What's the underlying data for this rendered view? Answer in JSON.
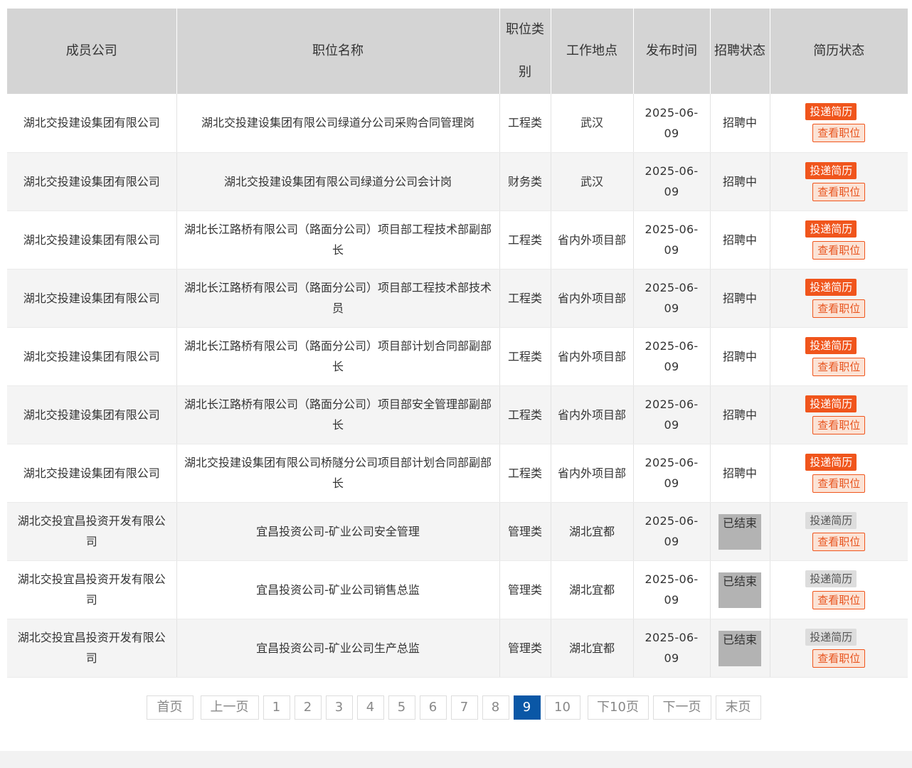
{
  "table": {
    "headers": {
      "company": "成员公司",
      "position": "职位名称",
      "category": "职位类别",
      "location": "工作地点",
      "publish_time": "发布时间",
      "recruit_status": "招聘状态",
      "resume_status": "简历状态"
    },
    "rows": [
      {
        "company": "湖北交投建设集团有限公司",
        "position": "湖北交投建设集团有限公司绿道分公司采购合同管理岗",
        "category": "工程类",
        "location": "武汉",
        "date": "2025-06-09",
        "status": "招聘中",
        "ended": false,
        "apply": "投递简历",
        "view": "查看职位"
      },
      {
        "company": "湖北交投建设集团有限公司",
        "position": "湖北交投建设集团有限公司绿道分公司会计岗",
        "category": "财务类",
        "location": "武汉",
        "date": "2025-06-09",
        "status": "招聘中",
        "ended": false,
        "apply": "投递简历",
        "view": "查看职位"
      },
      {
        "company": "湖北交投建设集团有限公司",
        "position": "湖北长江路桥有限公司（路面分公司）项目部工程技术部副部长",
        "category": "工程类",
        "location": "省内外项目部",
        "date": "2025-06-09",
        "status": "招聘中",
        "ended": false,
        "apply": "投递简历",
        "view": "查看职位"
      },
      {
        "company": "湖北交投建设集团有限公司",
        "position": "湖北长江路桥有限公司（路面分公司）项目部工程技术部技术员",
        "category": "工程类",
        "location": "省内外项目部",
        "date": "2025-06-09",
        "status": "招聘中",
        "ended": false,
        "apply": "投递简历",
        "view": "查看职位"
      },
      {
        "company": "湖北交投建设集团有限公司",
        "position": "湖北长江路桥有限公司（路面分公司）项目部计划合同部副部长",
        "category": "工程类",
        "location": "省内外项目部",
        "date": "2025-06-09",
        "status": "招聘中",
        "ended": false,
        "apply": "投递简历",
        "view": "查看职位"
      },
      {
        "company": "湖北交投建设集团有限公司",
        "position": "湖北长江路桥有限公司（路面分公司）项目部安全管理部副部长",
        "category": "工程类",
        "location": "省内外项目部",
        "date": "2025-06-09",
        "status": "招聘中",
        "ended": false,
        "apply": "投递简历",
        "view": "查看职位"
      },
      {
        "company": "湖北交投建设集团有限公司",
        "position": "湖北交投建设集团有限公司桥隧分公司项目部计划合同部副部长",
        "category": "工程类",
        "location": "省内外项目部",
        "date": "2025-06-09",
        "status": "招聘中",
        "ended": false,
        "apply": "投递简历",
        "view": "查看职位"
      },
      {
        "company": "湖北交投宜昌投资开发有限公司",
        "position": "宜昌投资公司-矿业公司安全管理",
        "category": "管理类",
        "location": "湖北宜都",
        "date": "2025-06-09",
        "status": "已结束",
        "ended": true,
        "apply": "投递简历",
        "view": "查看职位"
      },
      {
        "company": "湖北交投宜昌投资开发有限公司",
        "position": "宜昌投资公司-矿业公司销售总监",
        "category": "管理类",
        "location": "湖北宜都",
        "date": "2025-06-09",
        "status": "已结束",
        "ended": true,
        "apply": "投递简历",
        "view": "查看职位"
      },
      {
        "company": "湖北交投宜昌投资开发有限公司",
        "position": "宜昌投资公司-矿业公司生产总监",
        "category": "管理类",
        "location": "湖北宜都",
        "date": "2025-06-09",
        "status": "已结束",
        "ended": true,
        "apply": "投递简历",
        "view": "查看职位"
      }
    ]
  },
  "pagination": {
    "first": "首页",
    "prev": "上一页",
    "pages": [
      "1",
      "2",
      "3",
      "4",
      "5",
      "6",
      "7",
      "8",
      "9",
      "10"
    ],
    "current": "9",
    "next10": "下10页",
    "next": "下一页",
    "last": "末页"
  },
  "colors": {
    "header_bg": "#d4d4d4",
    "apply_active": "#f0551c",
    "view_border": "#f0551c",
    "current_page": "#0a57a6",
    "ended_badge": "#b3b3b3"
  }
}
